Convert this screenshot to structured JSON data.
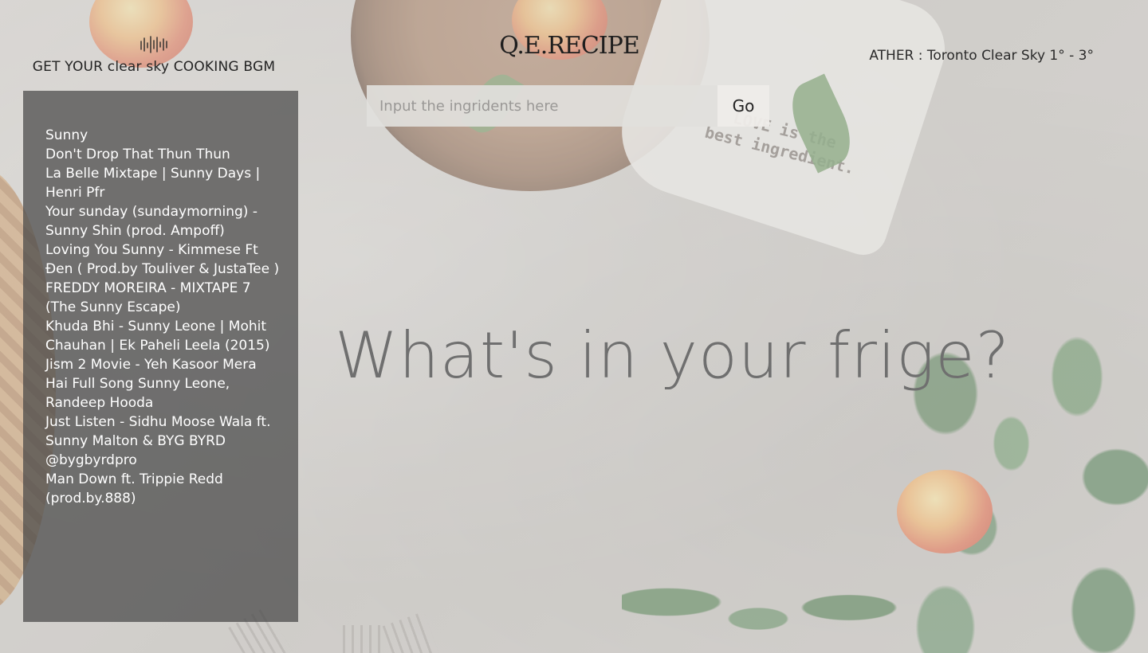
{
  "site": {
    "title": "Q.E.RECIPE"
  },
  "bgm": {
    "icon": "waveform-icon",
    "title": "GET YOUR clear sky COOKING BGM",
    "playlist": [
      "Sunny",
      "Don't Drop That Thun Thun",
      "La Belle Mixtape | Sunny Days | Henri Pfr",
      "Your sunday (sundaymorning) - Sunny Shin (prod. Ampoff)",
      "Loving You Sunny - Kimmese Ft Đen ( Prod.by Touliver & JustaTee )",
      "FREDDY MOREIRA - MIXTAPE 7 (The Sunny Escape)",
      "Khuda Bhi - Sunny Leone | Mohit Chauhan | Ek Paheli Leela (2015)",
      "Jism 2 Movie - Yeh Kasoor Mera Hai Full Song Sunny Leone, Randeep Hooda",
      "Just Listen - Sidhu Moose Wala ft. Sunny Malton & BYG BYRD @bygbyrdpro",
      "Man Down ft. Trippie Redd (prod.by.888)"
    ]
  },
  "weather": {
    "text": "ATHER : Toronto Clear Sky 1° - 3°"
  },
  "search": {
    "placeholder": "Input the ingridents here",
    "value": "",
    "button_label": "Go"
  },
  "hero": {
    "text": "What's in your frige?"
  },
  "background": {
    "napkin_text_line1": "LOVE is the",
    "napkin_text_line2": "best ingredient."
  },
  "colors": {
    "panel": "#464646",
    "hero_text": "#6f6f6f",
    "playlist_text": "#ffffff"
  }
}
